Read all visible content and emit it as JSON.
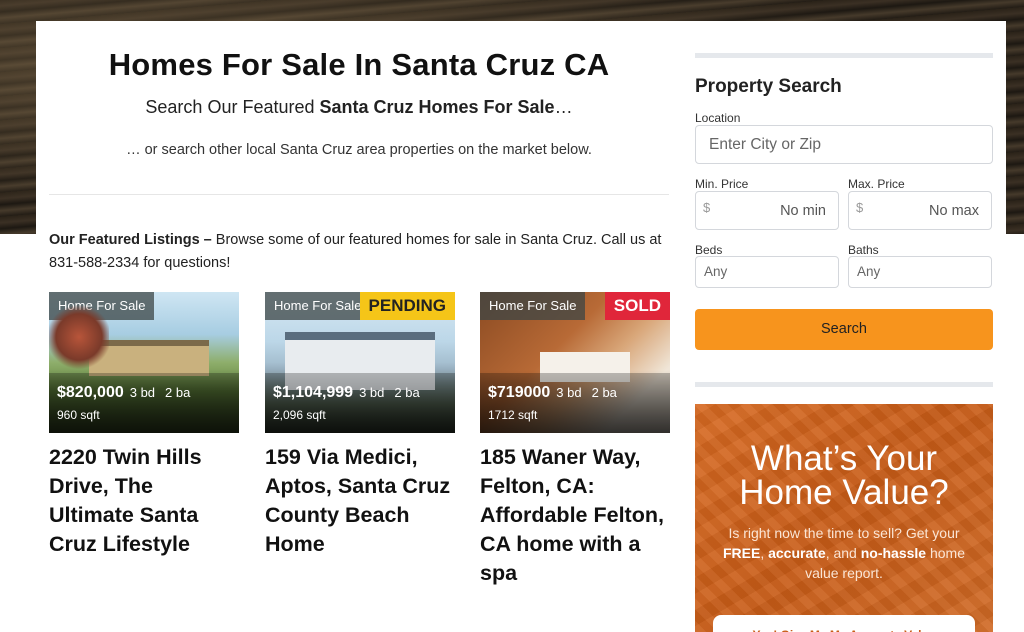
{
  "main": {
    "title": "Homes For Sale In Santa Cruz CA",
    "subtitle_pre": "Search Our Featured ",
    "subtitle_bold": "Santa Cruz Homes For Sale",
    "subtitle_post": "…",
    "subtext": "… or search other local Santa Cruz area properties on the market below.",
    "intro_bold": "Our Featured Listings –",
    "intro_text": " Browse some of our featured homes for sale in Santa Cruz. Call us at 831-588-2334 for questions!"
  },
  "listings": [
    {
      "tag": "Home For Sale",
      "status": "",
      "price": "$820,000",
      "beds": "3 bd",
      "baths": "2 ba",
      "sqft": "960 sqft",
      "title": "2220 Twin Hills Drive, The Ultimate Santa Cruz Lifestyle"
    },
    {
      "tag": "Home For Sale",
      "status": "PENDING",
      "price": "$1,104,999",
      "beds": "3 bd",
      "baths": "2 ba",
      "sqft": "2,096 sqft",
      "title": "159 Via Medici, Aptos, Santa Cruz County Beach Home"
    },
    {
      "tag": "Home For Sale",
      "status": "SOLD",
      "price": "$719000",
      "beds": "3 bd",
      "baths": "2 ba",
      "sqft": "1712 sqft",
      "title": "185 Waner Way, Felton, CA: Affordable Felton, CA home with a spa"
    }
  ],
  "search": {
    "heading": "Property Search",
    "location_label": "Location",
    "location_placeholder": "Enter City or Zip",
    "min_label": "Min. Price",
    "min_currency": "$",
    "min_value": "No min",
    "max_label": "Max. Price",
    "max_currency": "$",
    "max_value": "No max",
    "beds_label": "Beds",
    "beds_value": "Any",
    "baths_label": "Baths",
    "baths_value": "Any",
    "button": "Search"
  },
  "value_card": {
    "title_line1": "What’s Your",
    "title_line2": "Home Value?",
    "text_pre": "Is right now the time to sell? Get your ",
    "free": "FREE",
    "comma1": ", ",
    "accurate": "accurate",
    "and": ", and ",
    "nohassle": "no-hassle",
    "text_post": " home value report.",
    "cta": "Yes! Give Me My Accurate Value"
  },
  "colors": {
    "accent_orange": "#f7941d",
    "pending": "#f5c518",
    "sold": "#e0263a",
    "value_card": "#c85c17"
  }
}
